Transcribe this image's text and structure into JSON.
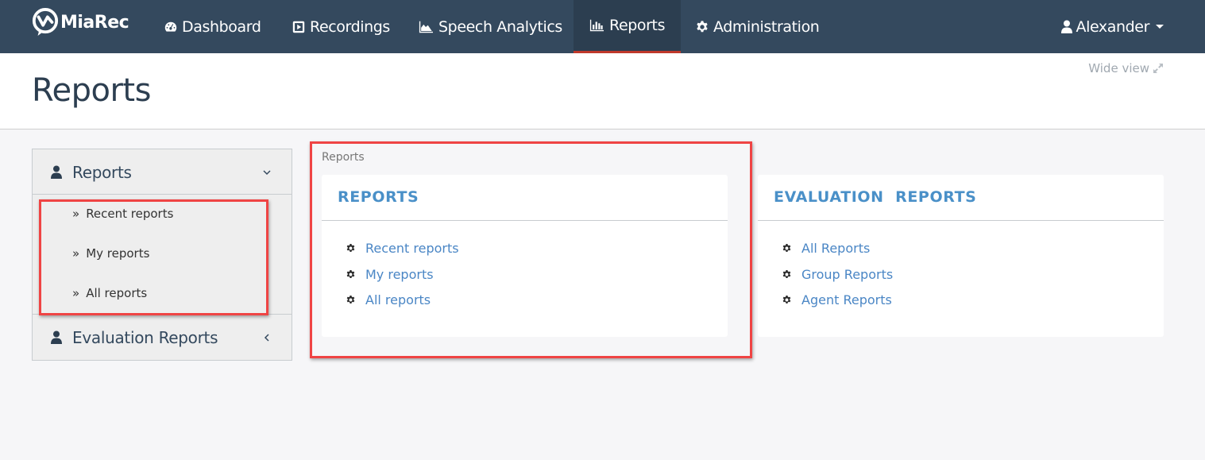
{
  "navbar": {
    "brand": "MiaRec",
    "items": [
      {
        "label": "Dashboard",
        "icon": "dashboard-icon",
        "active": false
      },
      {
        "label": "Recordings",
        "icon": "play-square-icon",
        "active": false
      },
      {
        "label": "Speech Analytics",
        "icon": "area-chart-icon",
        "active": false
      },
      {
        "label": "Reports",
        "icon": "bar-chart-icon",
        "active": true
      },
      {
        "label": "Administration",
        "icon": "gear-icon",
        "active": false
      }
    ],
    "user": "Alexander",
    "accent_color": "#c0392b",
    "background_color": "#34495e"
  },
  "header": {
    "title": "Reports",
    "wide_view": "Wide view"
  },
  "sidebar": {
    "sections": [
      {
        "label": "Reports",
        "expanded": true,
        "items": [
          "Recent reports",
          "My reports",
          "All reports"
        ]
      },
      {
        "label": "Evaluation Reports",
        "expanded": false,
        "items": []
      }
    ]
  },
  "main": {
    "breadcrumb": "Reports",
    "panels": [
      {
        "title": "REPORTS",
        "links": [
          "Recent reports",
          "My reports",
          "All reports"
        ]
      },
      {
        "title": "EVALUATION  REPORTS",
        "links": [
          "All Reports",
          "Group Reports",
          "Agent Reports"
        ]
      }
    ],
    "link_color": "#4a86c5",
    "title_color": "#4a90c8"
  }
}
